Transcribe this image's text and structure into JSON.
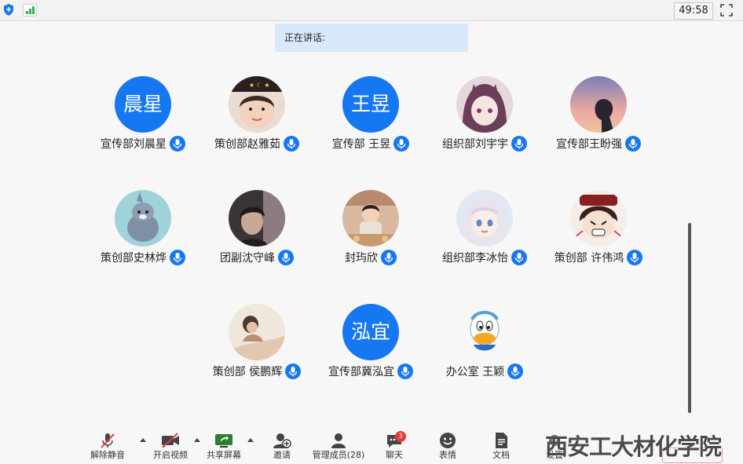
{
  "topbar": {
    "timer": "49:58"
  },
  "speaking": {
    "label": "正在讲话:"
  },
  "participants": [
    {
      "name": "宣传部刘晨星",
      "avatar_text": "晨星"
    },
    {
      "name": "策创部赵雅茹"
    },
    {
      "name": "宣传部 王昱",
      "avatar_text": "王昱"
    },
    {
      "name": "组织部刘宇宇"
    },
    {
      "name": "宣传部王盼强"
    },
    {
      "name": "策创部史林烨"
    },
    {
      "name": "团副沈守峰"
    },
    {
      "name": "封玙欣"
    },
    {
      "name": "组织部李冰怡"
    },
    {
      "name": "策创部 许伟鸿"
    },
    {
      "name": "策创部 侯鹏辉"
    },
    {
      "name": "宣传部冀泓宜",
      "avatar_text": "泓宜"
    },
    {
      "name": "办公室 王颖"
    }
  ],
  "toolbar": {
    "unmute": "解除静音",
    "start_video": "开启视频",
    "share_screen": "共享屏幕",
    "invite": "邀请",
    "manage_members": "管理成员(28)",
    "chat": "聊天",
    "chat_badge": "3",
    "reactions": "表情",
    "docs": "文档",
    "settings": "设置"
  },
  "watermark": "西安工大材化学院",
  "colors": {
    "accent": "#1677f2",
    "speaking_bg": "#d9e8fb",
    "badge": "#e53935"
  },
  "icons": [
    "shield-icon",
    "signal-icon",
    "fullscreen-icon",
    "mic-icon",
    "mic-muted-icon",
    "video-off-icon",
    "share-screen-icon",
    "invite-icon",
    "members-icon",
    "chat-icon",
    "emoji-icon",
    "document-icon",
    "settings-icon",
    "caret-up-icon"
  ]
}
